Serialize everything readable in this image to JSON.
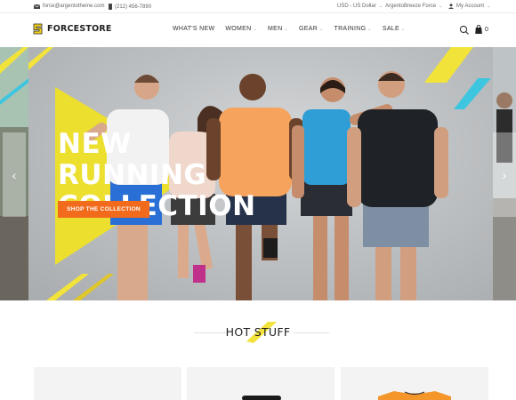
{
  "topbar": {
    "email": "force@argentotheme.com",
    "phone": "(212) 456-7890",
    "currency": "USD - US Dollar",
    "store": "ArgentoBreeze Force",
    "account": "My Account"
  },
  "header": {
    "logo_text": "FORCESTORE",
    "nav": [
      {
        "label": "WHAT'S NEW",
        "has_dropdown": false
      },
      {
        "label": "WOMEN",
        "has_dropdown": true
      },
      {
        "label": "MEN",
        "has_dropdown": true
      },
      {
        "label": "GEAR",
        "has_dropdown": true
      },
      {
        "label": "TRAINING",
        "has_dropdown": true
      },
      {
        "label": "SALE",
        "has_dropdown": true
      }
    ],
    "cart_count": "0"
  },
  "hero": {
    "title_line1": "NEW RUNNING",
    "title_line2": "COLLECTION",
    "cta_label": "SHOP THE COLLECTION"
  },
  "section": {
    "title": "HOT STUFF"
  },
  "colors": {
    "accent_orange": "#f26b1d",
    "accent_yellow": "#f2e33a",
    "accent_cyan": "#3ec6e0"
  },
  "icons": {
    "email": "envelope-icon",
    "phone": "phone-icon",
    "account": "user-icon",
    "search": "search-icon",
    "cart": "shopping-bag-icon",
    "prev": "chevron-left-icon",
    "next": "chevron-right-icon"
  }
}
